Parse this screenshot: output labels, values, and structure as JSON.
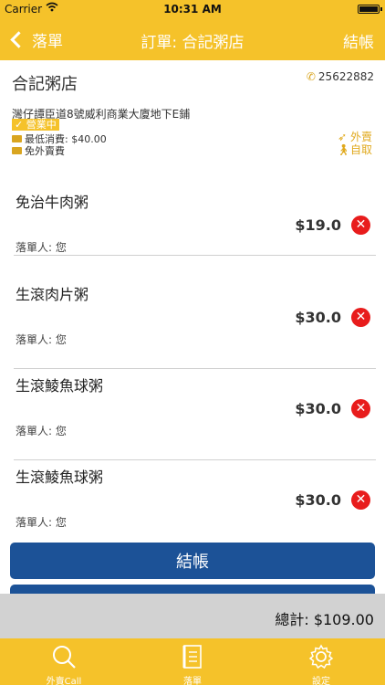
{
  "status_bar": {
    "carrier": "Carrier",
    "time": "10:31 AM",
    "battery_level": 1.0
  },
  "nav": {
    "back_label": "落單",
    "title": "訂單: 合記粥店",
    "action_label": "結帳"
  },
  "shop": {
    "name": "合記粥店",
    "phone": "25622882",
    "address": "灣仔譚臣道8號威利商業大廈地下E鋪",
    "status": "營業中",
    "min_spend": "最低消費: $40.00",
    "delivery_fee": "免外賣費",
    "options": [
      "外賣",
      "自取"
    ]
  },
  "orders": [
    {
      "name": "免治牛肉粥",
      "price": "$19.0",
      "orderer": "落單人: 您"
    },
    {
      "name": "生滾肉片粥",
      "price": "$30.0",
      "orderer": "落單人: 您"
    },
    {
      "name": "生滾鯪魚球粥",
      "price": "$30.0",
      "orderer": "落單人: 您"
    },
    {
      "name": "生滾鯪魚球粥",
      "price": "$30.0",
      "orderer": "落單人: 您"
    }
  ],
  "checkout_button": "結帳",
  "total": "總計: $109.00",
  "tabs": [
    {
      "label": "外賣Call",
      "icon": "search-icon"
    },
    {
      "label": "落單",
      "icon": "document-icon"
    },
    {
      "label": "設定",
      "icon": "gear-icon"
    }
  ],
  "colors": {
    "brand": "#f5c22a",
    "button": "#1c5297",
    "remove": "#e81c1c"
  }
}
